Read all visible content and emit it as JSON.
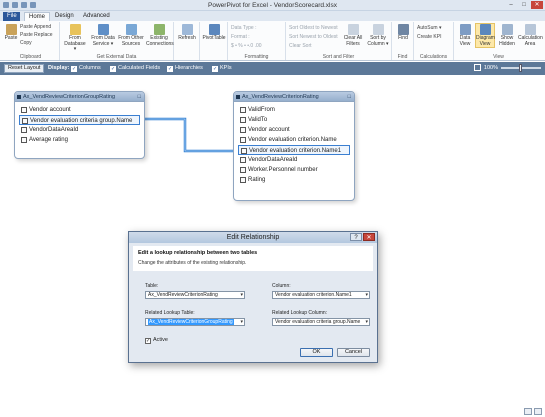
{
  "app": {
    "title": "PowerPivot for Excel - VendorScorecard.xlsx"
  },
  "window_controls": {
    "minimize": "–",
    "restore": "□",
    "close": "✕"
  },
  "tabs": [
    {
      "label": "File"
    },
    {
      "label": "Home"
    },
    {
      "label": "Design"
    },
    {
      "label": "Advanced"
    }
  ],
  "ribbon": {
    "clipboard": {
      "paste": "Paste",
      "paste_append": "Paste Append",
      "paste_replace": "Paste Replace",
      "copy": "Copy",
      "label": "Clipboard"
    },
    "external": {
      "from_database": "From Database ▾",
      "from_data_service": "From Data Service ▾",
      "from_other_sources": "From Other Sources",
      "existing_connections": "Existing Connections",
      "label": "Get External Data"
    },
    "refresh": "Refresh",
    "pivottable": "PivotTable",
    "formatting": {
      "data_type": "Data Type :",
      "format": "Format :",
      "symbols": "$ • % • •.0 .00",
      "label": "Formatting"
    },
    "sort": {
      "asc": "Sort Oldest to Newest",
      "desc": "Sort Newest to Oldest",
      "clear": "Clear Sort",
      "clear_all_filters": "Clear All Filters",
      "sort_by_column": "Sort by Column ▾",
      "label": "Sort and Filter"
    },
    "find": {
      "find": "Find",
      "label": "Find"
    },
    "calculations": {
      "autosum": "AutoSum ▾",
      "create_kpi": "Create KPI",
      "label": "Calculations"
    },
    "view": {
      "data_view": "Data View",
      "diagram_view": "Diagram View",
      "show_hidden": "Show Hidden",
      "calculation_area": "Calculation Area",
      "label": "View"
    }
  },
  "displaybar": {
    "reset_layout": "Reset Layout",
    "display_label": "Display:",
    "options": [
      {
        "label": "Columns",
        "checked": "✓"
      },
      {
        "label": "Calculated Fields",
        "checked": "✓"
      },
      {
        "label": "Hierarchies",
        "checked": "✓"
      },
      {
        "label": "KPIs",
        "checked": "✓"
      }
    ],
    "zoom": "100%"
  },
  "tables": [
    {
      "title": "Ax_VendReviewCriterionGroupRating",
      "fields": [
        "Vendor account",
        "Vendor evaluation criteria group.Name",
        "VendorDataAreaId",
        "Average rating"
      ],
      "selected_index": 1
    },
    {
      "title": "Ax_VendReviewCriterionRating",
      "fields": [
        "ValidFrom",
        "ValidTo",
        "Vendor account",
        "Vendor evaluation criterion.Name",
        "Vendor evaluation criterion.Name1",
        "VendorDataAreaId",
        "Worker.Personnel number",
        "Rating"
      ],
      "selected_index": 4
    }
  ],
  "dialog": {
    "title": "Edit Relationship",
    "help": "?",
    "heading": "Edit a lookup relationship between two tables",
    "subheading": "Change the attributes of the existing relationship.",
    "table_label": "Table:",
    "table_value": "Ax_VendReviewCriterionRating",
    "column_label": "Column:",
    "column_value": "Vendor evaluation criterion.Name1",
    "related_table_label": "Related Lookup Table:",
    "related_table_value": "Ax_VendReviewCriterionGroupRating",
    "related_column_label": "Related Lookup Column:",
    "related_column_value": "Vendor evaluation criteria group.Name",
    "active_label": "Active",
    "active_checked": "✓",
    "ok": "OK",
    "cancel": "Cancel"
  },
  "colors": {
    "accent": "#2b579a",
    "display_bar": "#5c7898",
    "connector": "#2f7fd4",
    "selection": "#3b7fd1"
  }
}
